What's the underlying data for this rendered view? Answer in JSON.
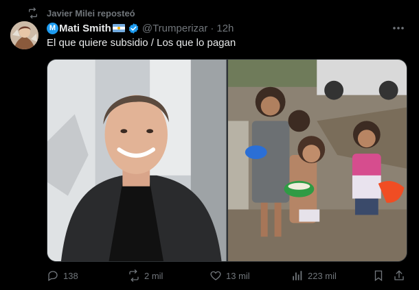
{
  "repost": {
    "label": "Javier Milei reposteó"
  },
  "tweet": {
    "name": "Mati Smith",
    "handle": "@Trumperizar",
    "dot": "·",
    "time": "12h",
    "text": "El que quiere subsidio / Los que lo pagan"
  },
  "metrics": {
    "replies": "138",
    "reposts": "2 mil",
    "likes": "13 mil",
    "views": "223 mil"
  },
  "colors": {
    "background": "#000000",
    "text_primary": "#e7e9ea",
    "text_secondary": "#71767b",
    "verified_blue": "#1d9bf0"
  },
  "icons": [
    "repost-icon",
    "verified-badge-icon",
    "argentina-flag-icon",
    "more-icon",
    "reply-icon",
    "retweet-icon",
    "like-icon",
    "views-icon",
    "bookmark-icon",
    "share-icon"
  ]
}
